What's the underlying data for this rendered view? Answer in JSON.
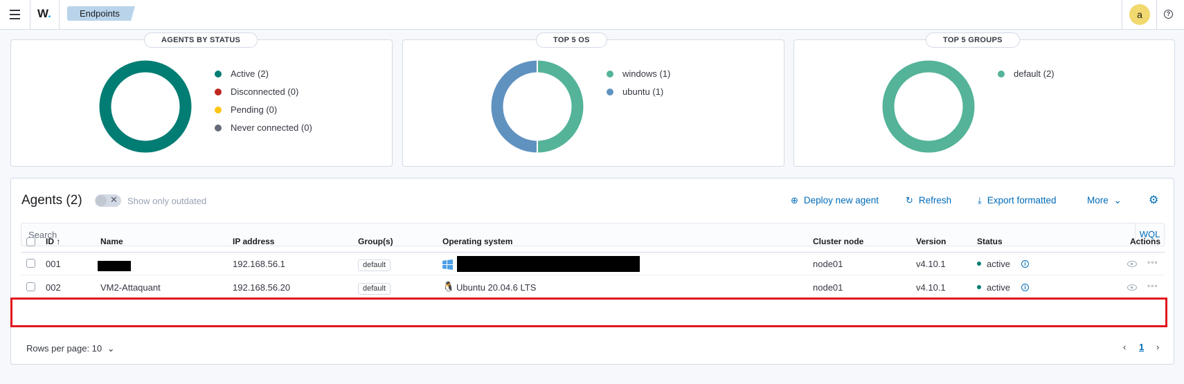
{
  "header": {
    "logo": "W",
    "breadcrumb": "Endpoints",
    "avatar_initial": "a",
    "help_symbol": "?"
  },
  "panels": [
    {
      "title": "AGENTS BY STATUS",
      "legend": [
        {
          "label": "Active (2)",
          "color": "#017d73"
        },
        {
          "label": "Disconnected (0)",
          "color": "#bd271e"
        },
        {
          "label": "Pending (0)",
          "color": "#fec514"
        },
        {
          "label": "Never connected (0)",
          "color": "#646a77"
        }
      ]
    },
    {
      "title": "TOP 5 OS",
      "legend": [
        {
          "label": "windows (1)",
          "color": "#54b399"
        },
        {
          "label": "ubuntu (1)",
          "color": "#6092c0"
        }
      ]
    },
    {
      "title": "TOP 5 GROUPS",
      "legend": [
        {
          "label": "default (2)",
          "color": "#54b399"
        }
      ]
    }
  ],
  "agents": {
    "title": "Agents (2)",
    "toggle_label": "Show only outdated",
    "toolbar": {
      "deploy": "Deploy new agent",
      "refresh": "Refresh",
      "export": "Export formatted",
      "more": "More"
    },
    "search_placeholder": "Search",
    "wql": "WQL",
    "columns": [
      "ID",
      "Name",
      "IP address",
      "Group(s)",
      "Operating system",
      "Cluster node",
      "Version",
      "Status",
      "Actions"
    ],
    "rows": [
      {
        "id": "001",
        "name": "",
        "ip": "192.168.56.1",
        "group": "default",
        "os": "",
        "cluster": "node01",
        "version": "v4.10.1",
        "status": "active"
      },
      {
        "id": "002",
        "name": "VM2-Attaquant",
        "ip": "192.168.56.20",
        "group": "default",
        "os": "Ubuntu 20.04.6 LTS",
        "cluster": "node01",
        "version": "v4.10.1",
        "status": "active"
      }
    ],
    "rows_per_page": "Rows per page: 10",
    "current_page": "1"
  }
}
